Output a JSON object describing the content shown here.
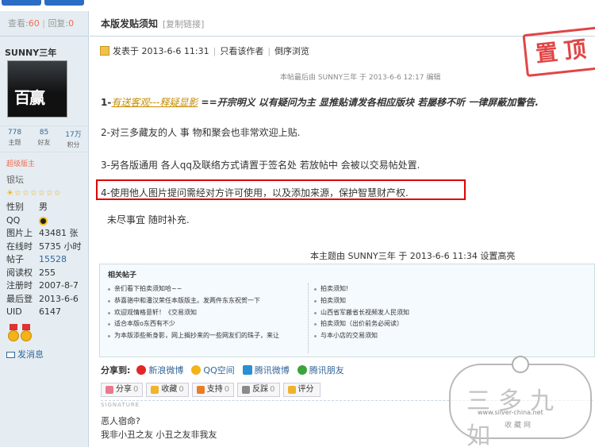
{
  "left": {
    "view_label": "查看:",
    "view_count": "60",
    "reply_label": "回复:",
    "reply_count": "0",
    "username": "SUNNY三年",
    "avatar_text": "百赢",
    "stats": [
      {
        "value": "778",
        "label": "主题"
      },
      {
        "value": "85",
        "label": "好友"
      },
      {
        "value": "17万",
        "label": "积分"
      }
    ],
    "rank": "超级版主",
    "level": "银坛",
    "stars": "☆☆☆☆☆☆",
    "profile": [
      {
        "key": "性别",
        "value": "男"
      },
      {
        "key": "QQ",
        "value": ""
      },
      {
        "key": "图片上",
        "value": "43481 张"
      },
      {
        "key": "在线时",
        "value": "5735 小时"
      },
      {
        "key": "帖子",
        "value": "15528"
      },
      {
        "key": "阅读权",
        "value": "255"
      },
      {
        "key": "注册时",
        "value": "2007-8-7"
      },
      {
        "key": "最后登",
        "value": "2013-6-6"
      },
      {
        "key": "UID",
        "value": "6147"
      }
    ],
    "send_message": "发消息"
  },
  "post": {
    "title": "本版发贴须知",
    "copy_link": "[复制链接]",
    "posted": "发表于 2013-6-6 11:31",
    "only_author": "只看该作者",
    "reverse": "倒序浏览",
    "stamp": "置顶",
    "edit_note": "本帖最后由 SUNNY三年 于 2013-6-6 12:17 编辑",
    "rule1_num": "1-",
    "rule1_link": "有送客观---释疑显影",
    "rule1_text": " ==开宗明义 以有疑问为主 显推贴请发各相应版块 若屡移不听 一律屏蔽加警告.",
    "rule2": "2-对三多藏友的人 事 物和聚会也非常欢迎上贴.",
    "rule3": "3-另各版通用 各人qq及联络方式请置于签名处 若放帖中 会被以交易帖处置.",
    "rule4": "4-使用他人图片提问需经对方许可使用，以及添加来源，保护智慧财产权.",
    "rule5": "未尽事宜 随时补充.",
    "set_note": "本主题由 SUNNY三年 于 2013-6-6 11:34 设置高亮"
  },
  "related": {
    "heading": "相关帖子",
    "left_items": [
      "亲们看下拍卖须知哈~~",
      "恭喜骆中和潘汉荣任本版版主。发两件东东祝贺一下",
      "欢迎观情格意轩！《交易须知",
      "适合本版o东西有不少",
      "为本版添些新身影，网上搁抄来的一些网友们的珠子，来让"
    ],
    "right_items": [
      "拍卖须知!",
      "拍卖须知",
      "山西省军搬省长视频发人民须知",
      "拍卖须知（出价前务必阅读）",
      "与本小店的交易须知"
    ]
  },
  "share": {
    "label": "分享到:",
    "items": [
      "新浪微博",
      "QQ空间",
      "腾讯微博",
      "腾讯朋友"
    ]
  },
  "actions": [
    {
      "label": "分享",
      "count": "0"
    },
    {
      "label": "收藏",
      "count": "0"
    },
    {
      "label": "支持",
      "count": "0"
    },
    {
      "label": "反踩",
      "count": "0"
    },
    {
      "label": "评分",
      "count": ""
    }
  ],
  "signature": {
    "label": "SIGNATURE",
    "line1": "恶人宿命?",
    "line2": "我非小丑之友 小丑之友非我友"
  },
  "watermark": {
    "title": "三多九如",
    "url": "www.silver-china.net",
    "sub": "收藏网"
  },
  "colors": {
    "accent": "#369",
    "highlight_red": "#dd0000",
    "stamp_red": "#d33333",
    "link_gold": "#c58c00"
  }
}
